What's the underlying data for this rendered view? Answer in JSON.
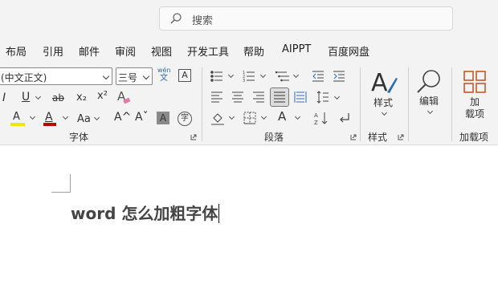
{
  "search": {
    "placeholder": "搜索"
  },
  "menu": {
    "items": [
      "布局",
      "引用",
      "邮件",
      "审阅",
      "视图",
      "开发工具",
      "帮助",
      "AIPPT",
      "百度网盘"
    ]
  },
  "font_group": {
    "font_name": "(中文正文)",
    "font_size": "三号",
    "label": "字体",
    "italic": "I",
    "underline": "U",
    "strikethrough": "ab",
    "subscript": "x₂",
    "superscript": "x²",
    "text_effects": "A",
    "highlight": "A",
    "font_color": "A",
    "change_case": "Aa",
    "grow_font": "A^",
    "shrink_font": "Aˇ",
    "char_shading": "A",
    "enclose": "字",
    "phonetic_top": "wén",
    "phonetic_bottom": "文",
    "char_border": "A"
  },
  "paragraph_group": {
    "label": "段落"
  },
  "styles_group": {
    "button": "样式",
    "label": "样式"
  },
  "editing_group": {
    "button": "编辑"
  },
  "addins_group": {
    "button_line1": "加",
    "button_line2": "载项",
    "label": "加载项"
  },
  "document": {
    "text": "word 怎么加粗字体"
  },
  "colors": {
    "highlight": "#f5e400",
    "font_color": "#c00000",
    "addin_icon": "#c55a28"
  }
}
